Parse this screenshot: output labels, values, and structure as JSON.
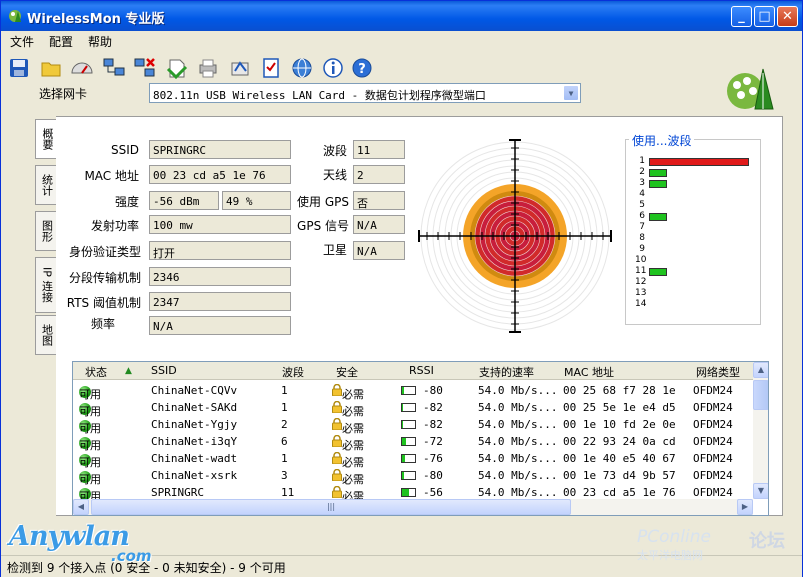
{
  "window": {
    "title": "WirelessMon 专业版"
  },
  "menu": [
    "文件",
    "配置",
    "帮助"
  ],
  "toolbar_icons": [
    "save-icon",
    "open-folder-icon",
    "gauge-icon",
    "network-computers-icon",
    "disconnect-icon",
    "print-icon",
    "printer-icon",
    "scan-icon",
    "checklist-icon",
    "globe-icon",
    "info-icon",
    "help-icon"
  ],
  "adapter": {
    "label": "选择网卡",
    "value": "802.11n USB Wireless LAN Card - 数据包计划程序微型端口"
  },
  "tabs": [
    "概要",
    "统计",
    "图形",
    "IP 连接",
    "地图"
  ],
  "fields_left": [
    {
      "label": "SSID",
      "value": "SPRINGRC"
    },
    {
      "label": "MAC 地址",
      "value": "00 23 cd a5 1e 76"
    },
    {
      "label": "强度",
      "value": "-56 dBm",
      "value2": "49 %"
    },
    {
      "label": "发射功率",
      "value": "100 mw"
    },
    {
      "label": "身份验证类型",
      "value": "打开"
    },
    {
      "label": "分段传输机制",
      "value": "2346"
    },
    {
      "label": "RTS 阈值机制",
      "value": "2347"
    },
    {
      "label": "频率",
      "value": "N/A"
    }
  ],
  "fields_mid": [
    {
      "label": "波段",
      "value": "11"
    },
    {
      "label": "天线",
      "value": "2"
    },
    {
      "label": "使用 GPS",
      "value": "否"
    },
    {
      "label": "GPS 信号",
      "value": "N/A"
    },
    {
      "label": "卫星",
      "value": "N/A"
    }
  ],
  "channel_usage": {
    "title": "使用...波段",
    "channels": [
      {
        "ch": "1",
        "level": 3,
        "color": "#e01a1a"
      },
      {
        "ch": "2",
        "level": 1,
        "color": "#1fc31f"
      },
      {
        "ch": "3",
        "level": 1,
        "color": "#1fc31f"
      },
      {
        "ch": "4",
        "level": 0,
        "color": "#1fc31f"
      },
      {
        "ch": "5",
        "level": 0,
        "color": "#1fc31f"
      },
      {
        "ch": "6",
        "level": 1,
        "color": "#1fc31f"
      },
      {
        "ch": "7",
        "level": 0,
        "color": "#1fc31f"
      },
      {
        "ch": "8",
        "level": 0,
        "color": "#1fc31f"
      },
      {
        "ch": "9",
        "level": 0,
        "color": "#1fc31f"
      },
      {
        "ch": "10",
        "level": 0,
        "color": "#1fc31f"
      },
      {
        "ch": "11",
        "level": 1,
        "color": "#1fc31f"
      },
      {
        "ch": "12",
        "level": 0,
        "color": "#1fc31f"
      },
      {
        "ch": "13",
        "level": 0,
        "color": "#1fc31f"
      },
      {
        "ch": "14",
        "level": 0,
        "color": "#1fc31f"
      }
    ]
  },
  "table": {
    "headers": [
      "状态",
      "SSID",
      "波段",
      "安全",
      "RSSI",
      "支持的速率",
      "MAC 地址",
      "网络类型"
    ],
    "rows": [
      {
        "status": "可用",
        "ssid": "ChinaNet-CQVv",
        "channel": "1",
        "security": "必需",
        "rssi": "-80",
        "rate": "54.0 Mb/s...",
        "mac": "00 25 68 f7 28 1e",
        "type": "OFDM24",
        "sig": 0.15
      },
      {
        "status": "可用",
        "ssid": "ChinaNet-SAKd",
        "channel": "1",
        "security": "必需",
        "rssi": "-82",
        "rate": "54.0 Mb/s...",
        "mac": "00 25 5e 1e e4 d5",
        "type": "OFDM24",
        "sig": 0.1
      },
      {
        "status": "可用",
        "ssid": "ChinaNet-Ygjy",
        "channel": "2",
        "security": "必需",
        "rssi": "-82",
        "rate": "54.0 Mb/s...",
        "mac": "00 1e 10 fd 2e 0e",
        "type": "OFDM24",
        "sig": 0.1
      },
      {
        "status": "可用",
        "ssid": "ChinaNet-i3qY",
        "channel": "6",
        "security": "必需",
        "rssi": "-72",
        "rate": "54.0 Mb/s...",
        "mac": "00 22 93 24 0a cd",
        "type": "OFDM24",
        "sig": 0.3
      },
      {
        "status": "可用",
        "ssid": "ChinaNet-wadt",
        "channel": "1",
        "security": "必需",
        "rssi": "-76",
        "rate": "54.0 Mb/s...",
        "mac": "00 1e 40 e5 40 67",
        "type": "OFDM24",
        "sig": 0.2
      },
      {
        "status": "可用",
        "ssid": "ChinaNet-xsrk",
        "channel": "3",
        "security": "必需",
        "rssi": "-80",
        "rate": "54.0 Mb/s...",
        "mac": "00 1e 73 d4 9b 57",
        "type": "OFDM24",
        "sig": 0.15
      },
      {
        "status": "可用",
        "ssid": "SPRINGRC",
        "channel": "11",
        "security": "必需",
        "rssi": "-56",
        "rate": "54.0 Mb/s...",
        "mac": "00 23 cd a5 1e 76",
        "type": "OFDM24",
        "sig": 0.5
      }
    ]
  },
  "statusbar": "检测到 9 个接入点 (0 安全 - 0 未知安全) - 9 个可用",
  "watermarks": {
    "left": "Anywlan",
    "left2": ".com",
    "right": "PConline",
    "right2": "太平洋电脑网",
    "right3": "论坛"
  }
}
